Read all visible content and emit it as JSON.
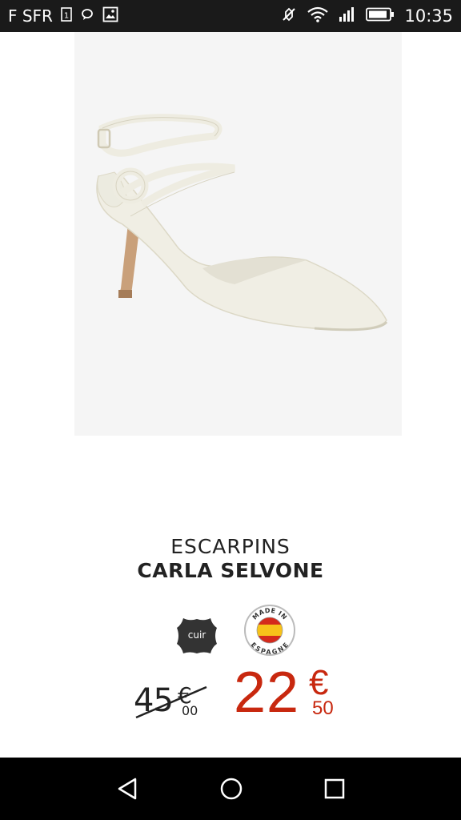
{
  "status_bar": {
    "carrier": "F SFR",
    "sim_slot": "1",
    "time": "10:35",
    "icons": [
      "sim-icon",
      "chat-icon",
      "image-icon",
      "mute-icon",
      "wifi-icon",
      "signal-icon",
      "battery-icon"
    ]
  },
  "product": {
    "image_alt": "White strappy pointed heel shoe",
    "category": "ESCARPINS",
    "name": "CARLA SELVONE",
    "badges": {
      "leather_label": "cuir",
      "made_in_top": "MADE IN",
      "made_in_bottom": "ESPAGNE"
    },
    "old_price": {
      "integer": "45",
      "currency": "€",
      "decimals": "00"
    },
    "new_price": {
      "integer": "22",
      "currency": "€",
      "decimals": "50"
    }
  },
  "nav_bar": {
    "icons": [
      "back-icon",
      "home-icon",
      "recent-apps-icon"
    ]
  },
  "colors": {
    "status_bar_bg": "#1a1a1a",
    "price_accent": "#c8280f",
    "nav_bar_bg": "#000000"
  }
}
